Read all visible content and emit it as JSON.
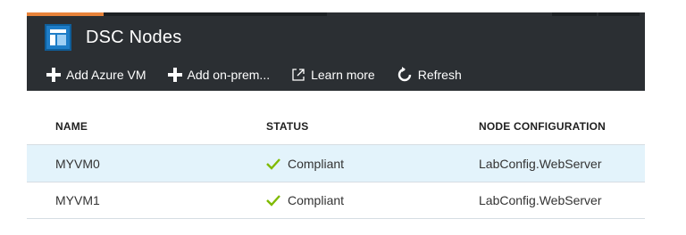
{
  "blade": {
    "title": "DSC Nodes",
    "title_icon": "dsc-nodes-icon",
    "accent_color": "#e8833a"
  },
  "toolbar": {
    "add_azure_vm": "Add Azure VM",
    "add_on_prem": "Add on-prem...",
    "learn_more": "Learn more",
    "refresh": "Refresh"
  },
  "table": {
    "headers": [
      "NAME",
      "STATUS",
      "NODE CONFIGURATION"
    ],
    "rows": [
      {
        "name": "MYVM0",
        "status": "Compliant",
        "node_configuration": "LabConfig.WebServer",
        "selected": true
      },
      {
        "name": "MYVM1",
        "status": "Compliant",
        "node_configuration": "LabConfig.WebServer",
        "selected": false
      }
    ],
    "status_color": "#7fba00"
  }
}
